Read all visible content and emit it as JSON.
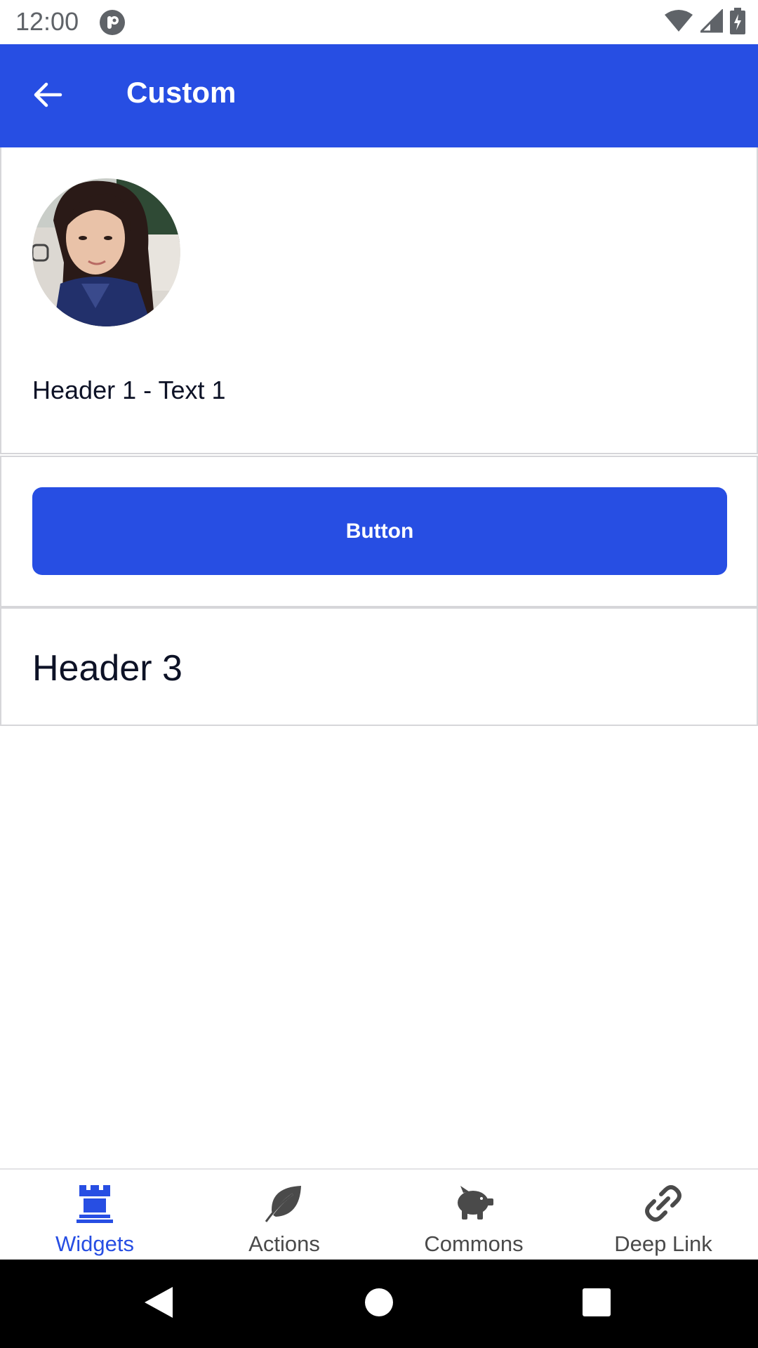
{
  "status_bar": {
    "time": "12:00"
  },
  "app_bar": {
    "title": "Custom",
    "back_icon": "arrow-back-icon",
    "color": "#274ee3"
  },
  "sections": {
    "header_1": {
      "avatar_alt": "profile photo",
      "text": "Header 1 - Text 1"
    },
    "header_2": {
      "button_label": "Button"
    },
    "header_3": {
      "text": "Header 3"
    }
  },
  "bottom_nav": {
    "active_color": "#274ee3",
    "items": [
      {
        "label": "Widgets",
        "icon": "chess-rook-icon",
        "active": true
      },
      {
        "label": "Actions",
        "icon": "leaf-icon",
        "active": false
      },
      {
        "label": "Commons",
        "icon": "piggy-bank-icon",
        "active": false
      },
      {
        "label": "Deep Link",
        "icon": "link-icon",
        "active": false
      }
    ]
  }
}
